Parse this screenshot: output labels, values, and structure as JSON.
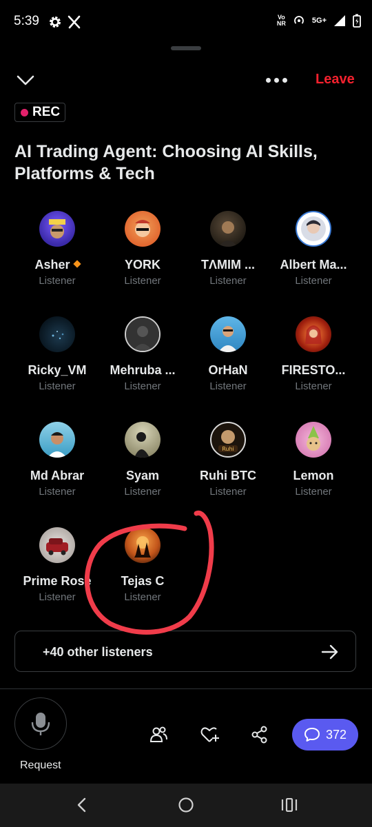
{
  "status_bar": {
    "time": "5:39",
    "volte_top": "Vo",
    "volte_bottom": "NR",
    "network": "5G+",
    "icons": [
      "gear-icon",
      "x-logo-icon",
      "hotspot-icon",
      "signal-icon",
      "battery-icon"
    ]
  },
  "header": {
    "leave_label": "Leave",
    "leave_color": "#f4212e"
  },
  "rec": {
    "label": "REC",
    "dot_color": "#e3216b"
  },
  "space": {
    "title": "AI Trading Agent: Choosing AI Skills, Platforms & Tech"
  },
  "participants": [
    {
      "name": "Asher",
      "role": "Listener",
      "verified": true
    },
    {
      "name": "YORK",
      "role": "Listener"
    },
    {
      "name": "TΛMIM ...",
      "role": "Listener"
    },
    {
      "name": "Albert Ma...",
      "role": "Listener"
    },
    {
      "name": "Ricky_VM",
      "role": "Listener"
    },
    {
      "name": "Mehruba ...",
      "role": "Listener"
    },
    {
      "name": "OrHaN",
      "role": "Listener"
    },
    {
      "name": "FIRESTO...",
      "role": "Listener"
    },
    {
      "name": "Md Abrar",
      "role": "Listener"
    },
    {
      "name": "Syam",
      "role": "Listener"
    },
    {
      "name": "Ruhi BTC",
      "role": "Listener"
    },
    {
      "name": "Lemon",
      "role": "Listener"
    },
    {
      "name": "Prime Rose",
      "role": "Listener"
    },
    {
      "name": "Tejas C",
      "role": "Listener"
    }
  ],
  "others": {
    "label": "+40 other listeners"
  },
  "bottom": {
    "request_label": "Request",
    "chat_count": "372",
    "chat_color": "#5a5af0"
  },
  "annotation": {
    "color": "#f03c4a"
  }
}
